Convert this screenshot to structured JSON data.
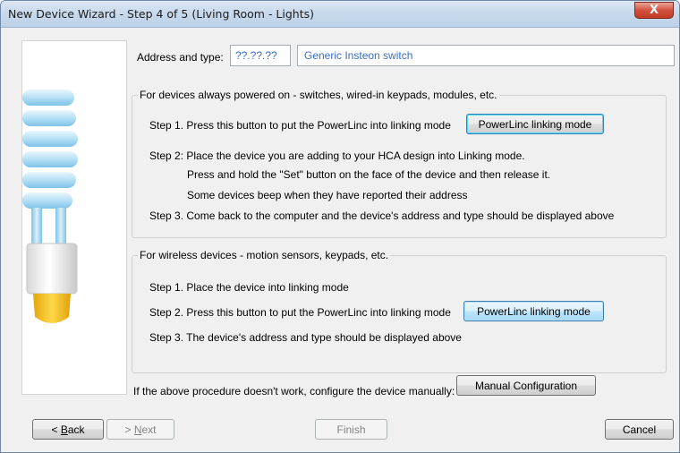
{
  "window": {
    "title": "New Device Wizard - Step 4 of 5 (Living Room - Lights)",
    "close_glyph": "X"
  },
  "address": {
    "label": "Address and type:",
    "value": "??.??.??",
    "type_value": "Generic Insteon switch"
  },
  "wired": {
    "title": "For devices always powered on - switches, wired-in keypads, modules, etc.",
    "step1": "Step 1. Press this button to put the PowerLinc into linking mode",
    "button": "PowerLinc linking mode",
    "step2": "Step 2:  Place the device you are adding to your HCA design into Linking mode.",
    "step2_detail1": "Press and hold the \"Set\" button on the face of the device and then release it.",
    "step2_detail2": "Some devices beep when they have reported their address",
    "step3": "Step 3. Come back to the computer and the device's address and type should be displayed above"
  },
  "wireless": {
    "title": "For wireless devices - motion sensors, keypads, etc.",
    "step1": "Step 1. Place the device into linking mode",
    "step2": "Step 2. Press this button to put the PowerLinc into linking mode",
    "button": "PowerLinc linking mode",
    "step3": "Step 3. The device's address and type should be displayed above"
  },
  "manual": {
    "text": "If the above procedure doesn't work, configure the device manually:",
    "button": "Manual Configuration"
  },
  "nav": {
    "back_prefix": "< ",
    "back_accel": "B",
    "back_rest": "ack",
    "next_prefix": "> ",
    "next_accel": "N",
    "next_rest": "ext",
    "finish": "Finish",
    "cancel": "Cancel"
  },
  "colors": {
    "accent": "#3a6ec9",
    "bulb_blue": "#a9d8f2",
    "bulb_base": "#f2c21b"
  },
  "icons": {
    "illustration": "light-bulb-icon"
  }
}
